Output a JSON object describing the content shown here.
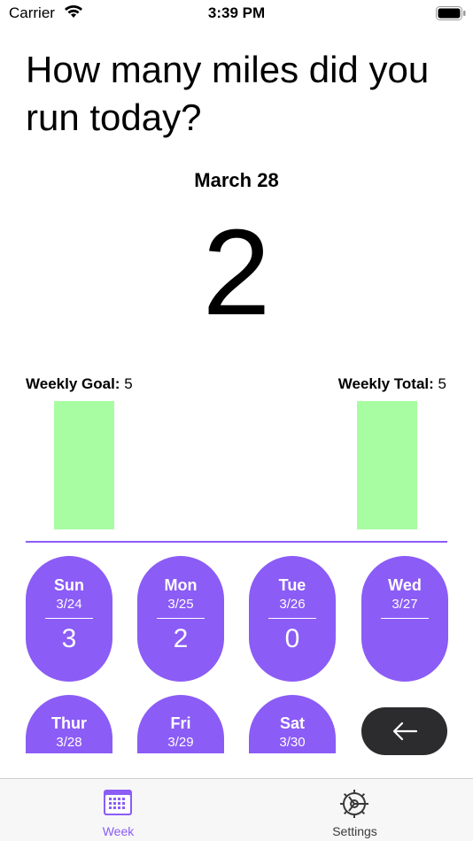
{
  "status_bar": {
    "carrier": "Carrier",
    "time": "3:39 PM"
  },
  "question": "How many miles did you run today?",
  "date": "March 28",
  "today_miles": "2",
  "weekly_goal": {
    "label": "Weekly Goal:",
    "value": "5"
  },
  "weekly_total": {
    "label": "Weekly Total:",
    "value": "5"
  },
  "days": [
    {
      "name": "Sun",
      "date": "3/24",
      "miles": "3"
    },
    {
      "name": "Mon",
      "date": "3/25",
      "miles": "2"
    },
    {
      "name": "Tue",
      "date": "3/26",
      "miles": "0"
    },
    {
      "name": "Wed",
      "date": "3/27",
      "miles": ""
    },
    {
      "name": "Thur",
      "date": "3/28",
      "miles": ""
    },
    {
      "name": "Fri",
      "date": "3/29",
      "miles": ""
    },
    {
      "name": "Sat",
      "date": "3/30",
      "miles": ""
    }
  ],
  "back_button": {
    "icon": "arrow-left-icon"
  },
  "tabs": [
    {
      "label": "Week",
      "icon": "calendar-icon",
      "selected": true
    },
    {
      "label": "Settings",
      "icon": "gear-icon",
      "selected": false
    }
  ],
  "colors": {
    "accent": "#8b5cf6",
    "bar_fill": "#a8fca2",
    "back_button": "#2c2c2e"
  }
}
